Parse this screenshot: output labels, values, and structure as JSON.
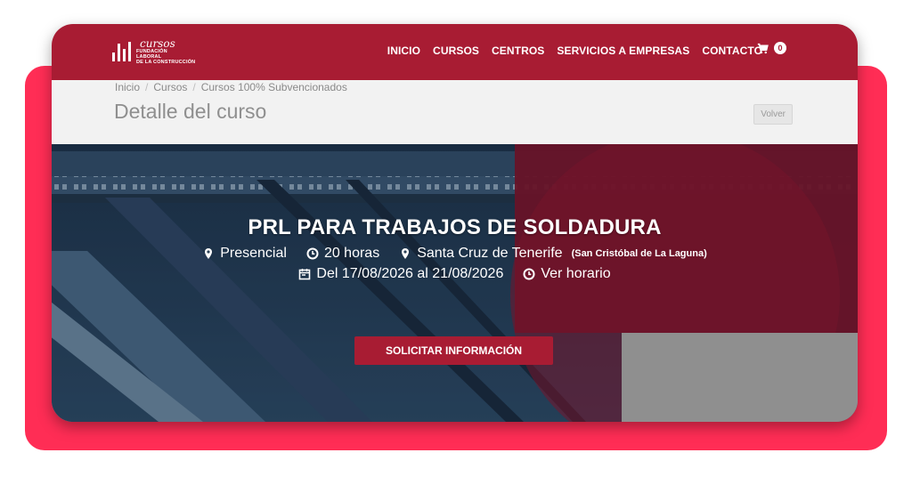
{
  "brand": {
    "script": "cursos",
    "line1": "FUNDACIÓN",
    "line2": "LABORAL",
    "line3": "DE LA CONSTRUCCIÓN"
  },
  "nav": {
    "items": [
      {
        "label": "INICIO"
      },
      {
        "label": "CURSOS"
      },
      {
        "label": "CENTROS"
      },
      {
        "label": "SERVICIOS A EMPRESAS"
      },
      {
        "label": "CONTACTO"
      }
    ],
    "cart_count": "0",
    "cart_icon": "shopping-cart-icon"
  },
  "breadcrumb": {
    "items": [
      "Inicio",
      "Cursos",
      "Cursos 100% Subvencionados"
    ],
    "separator": "/"
  },
  "page": {
    "title": "Detalle del curso",
    "back_label": "Volver"
  },
  "course": {
    "title": "PRL PARA TRABAJOS DE SOLDADURA",
    "modality": "Presencial",
    "hours": "20 horas",
    "location": "Santa Cruz de Tenerife",
    "sublocation": "(San Cristóbal de La Laguna)",
    "dates": "Del 17/08/2026 al 21/08/2026",
    "schedule_link": "Ver horario",
    "cta": "SOLICITAR INFORMACIÓN"
  },
  "colors": {
    "brand": "#a81c33",
    "backdrop": "#ff2d55",
    "hero_blue": "#27425e"
  }
}
